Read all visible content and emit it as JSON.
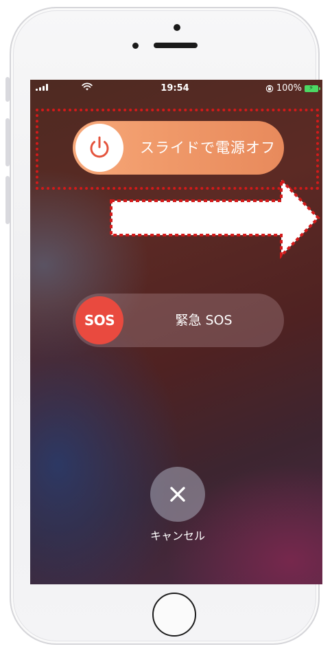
{
  "status_bar": {
    "time": "19:54",
    "battery_percent": "100%",
    "icons": [
      "signal-icon",
      "wifi-icon",
      "orientation-lock-icon",
      "battery-charging-icon"
    ]
  },
  "power_slider": {
    "label": "スライドで電源オフ",
    "icon": "power-icon"
  },
  "sos_slider": {
    "knob_label": "SOS",
    "label": "緊急 SOS"
  },
  "cancel": {
    "label": "キャンセル",
    "icon": "close-icon"
  },
  "annotation": {
    "highlight_color": "#d41a1a",
    "arrow_direction": "right"
  }
}
